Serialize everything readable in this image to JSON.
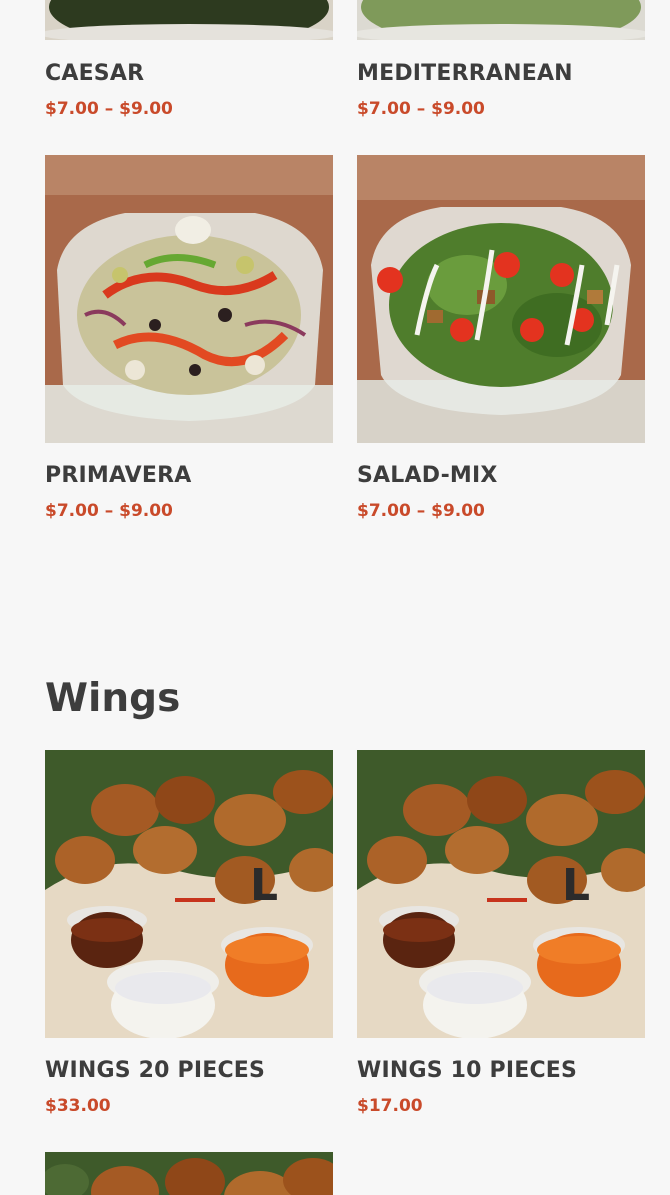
{
  "salads": {
    "items": [
      {
        "name": "CAESAR",
        "price": "$7.00 – $9.00",
        "image": "caesar-salad-photo"
      },
      {
        "name": "MEDITERRANEAN",
        "price": "$7.00 – $9.00",
        "image": "mediterranean-salad-photo"
      },
      {
        "name": "PRIMAVERA",
        "price": "$7.00 – $9.00",
        "image": "primavera-salad-photo"
      },
      {
        "name": "SALAD-MIX",
        "price": "$7.00 – $9.00",
        "image": "salad-mix-photo"
      }
    ]
  },
  "wings": {
    "heading": "Wings",
    "items": [
      {
        "name": "WINGS 20 PIECES",
        "price": "$33.00",
        "image": "wings-photo"
      },
      {
        "name": "WINGS 10 PIECES",
        "price": "$17.00",
        "image": "wings-photo"
      },
      {
        "name": "",
        "price": "",
        "image": "wings-photo"
      }
    ]
  },
  "colors": {
    "background": "#f7f7f7",
    "title": "#3d3d3d",
    "price_accent": "#c94a2a"
  }
}
